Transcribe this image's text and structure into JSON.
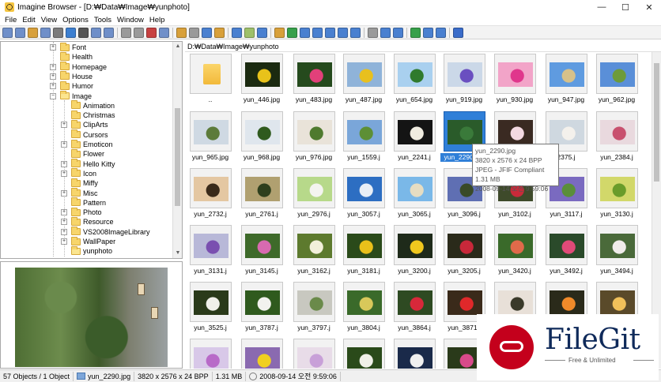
{
  "window": {
    "title": "Imagine Browser - [D:₩Data₩Image₩yunphoto]",
    "minimize": "—",
    "maximize": "☐",
    "close": "✕"
  },
  "menu": [
    "File",
    "Edit",
    "View",
    "Options",
    "Tools",
    "Window",
    "Help"
  ],
  "toolbar": {
    "colors": [
      "#6f8fc9",
      "#6f8fc9",
      "#d8a03a",
      "#6f8fc9",
      "#7b7b7b",
      "#3c7fd0",
      "#555555",
      "#6f8fc9",
      "#6f8fc9",
      "#9a9a9a",
      "#9a9a9a",
      "#c74141",
      "#6f8fc9",
      "#d8a03a",
      "#9a9a9a",
      "#4a80d0",
      "#d8a03a",
      "#4a80d0",
      "#9ec06a",
      "#4a80d0",
      "#d8a03a",
      "#37a04a",
      "#4a80d0",
      "#4a80d0",
      "#4a80d0",
      "#4a80d0",
      "#4a80d0",
      "#9a9a9a",
      "#4a80d0",
      "#4a80d0",
      "#37a04a",
      "#4a80d0",
      "#4a80d0",
      "#3a6cc9"
    ]
  },
  "tree": {
    "items": [
      {
        "label": "Font",
        "depth": 0,
        "expander": "+",
        "open": false
      },
      {
        "label": "Health",
        "depth": 0,
        "expander": "",
        "open": false
      },
      {
        "label": "Homepage",
        "depth": 0,
        "expander": "+",
        "open": false
      },
      {
        "label": "House",
        "depth": 0,
        "expander": "+",
        "open": false
      },
      {
        "label": "Humor",
        "depth": 0,
        "expander": "+",
        "open": false
      },
      {
        "label": "Image",
        "depth": 0,
        "expander": "−",
        "open": true
      },
      {
        "label": "Animation",
        "depth": 1,
        "expander": "",
        "open": false
      },
      {
        "label": "Christmas",
        "depth": 1,
        "expander": "",
        "open": false
      },
      {
        "label": "ClipArts",
        "depth": 1,
        "expander": "+",
        "open": false
      },
      {
        "label": "Cursors",
        "depth": 1,
        "expander": "",
        "open": false
      },
      {
        "label": "Emoticon",
        "depth": 1,
        "expander": "+",
        "open": false
      },
      {
        "label": "Flower",
        "depth": 1,
        "expander": "",
        "open": false
      },
      {
        "label": "Hello Kitty",
        "depth": 1,
        "expander": "+",
        "open": false
      },
      {
        "label": "Icon",
        "depth": 1,
        "expander": "+",
        "open": false
      },
      {
        "label": "Miffy",
        "depth": 1,
        "expander": "",
        "open": false
      },
      {
        "label": "Misc",
        "depth": 1,
        "expander": "+",
        "open": false
      },
      {
        "label": "Pattern",
        "depth": 1,
        "expander": "",
        "open": false
      },
      {
        "label": "Photo",
        "depth": 1,
        "expander": "+",
        "open": false
      },
      {
        "label": "Resource",
        "depth": 1,
        "expander": "+",
        "open": false
      },
      {
        "label": "VS2008ImageLibrary",
        "depth": 1,
        "expander": "+",
        "open": false
      },
      {
        "label": "WallPaper",
        "depth": 1,
        "expander": "+",
        "open": false
      },
      {
        "label": "yunphoto",
        "depth": 1,
        "expander": "",
        "open": true
      }
    ]
  },
  "path": "D:₩Data₩Image₩yunphoto",
  "thumbnails": [
    {
      "label": "..",
      "colors": [
        "#fbd56a",
        "#f2b93a"
      ],
      "folder": true
    },
    {
      "label": "yun_446.jpg",
      "colors": [
        "#1b2a10",
        "#e8c21a"
      ]
    },
    {
      "label": "yun_483.jpg",
      "colors": [
        "#254a1d",
        "#e2407a"
      ]
    },
    {
      "label": "yun_487.jpg",
      "colors": [
        "#8fb3d9",
        "#e8c01e"
      ]
    },
    {
      "label": "yun_654.jpg",
      "colors": [
        "#a9d0ef",
        "#2f7a2d"
      ]
    },
    {
      "label": "yun_919.jpg",
      "colors": [
        "#cbd8e8",
        "#6a4fc0"
      ]
    },
    {
      "label": "yun_930.jpg",
      "colors": [
        "#f2a4c8",
        "#e0368c"
      ]
    },
    {
      "label": "yun_947.jpg",
      "colors": [
        "#5f9be0",
        "#d7c18a"
      ]
    },
    {
      "label": "yun_962.jpg",
      "colors": [
        "#5a8fd8",
        "#6d9b3a"
      ]
    },
    {
      "label": "yun_965.jpg",
      "colors": [
        "#cfd9e3",
        "#5c7b3a"
      ]
    },
    {
      "label": "yun_968.jpg",
      "colors": [
        "#dfe6ed",
        "#2f5a1e"
      ]
    },
    {
      "label": "yun_976.jpg",
      "colors": [
        "#e9e3d9",
        "#4f7a2e"
      ]
    },
    {
      "label": "yun_1559.j",
      "colors": [
        "#7aa6d9",
        "#5d8f36"
      ]
    },
    {
      "label": "yun_2241.j",
      "colors": [
        "#141414",
        "#f0ece0"
      ]
    },
    {
      "label": "yun_2290.jpg",
      "colors": [
        "#2a5b2a",
        "#3a7a3a"
      ],
      "selected": true
    },
    {
      "label": "",
      "colors": [
        "#3a2a22",
        "#f4d9e2"
      ]
    },
    {
      "label": "2375.j",
      "colors": [
        "#cfd8e0",
        "#f4f1ec"
      ]
    },
    {
      "label": "yun_2384.j",
      "colors": [
        "#e9d9de",
        "#c8506e"
      ]
    },
    {
      "label": "yun_2732.j",
      "colors": [
        "#e4c7a2",
        "#3a2a1a"
      ]
    },
    {
      "label": "yun_2761.j",
      "colors": [
        "#b0a070",
        "#2e3f1d"
      ]
    },
    {
      "label": "yun_2976.j",
      "colors": [
        "#b7d98a",
        "#f4f4f0"
      ]
    },
    {
      "label": "yun_3057.j",
      "colors": [
        "#2d6ec2",
        "#e8eef6"
      ]
    },
    {
      "label": "yun_3065.j",
      "colors": [
        "#7ab8e8",
        "#e6ddc2"
      ]
    },
    {
      "label": "yun_3096.j",
      "colors": [
        "#5f6fb3",
        "#394a28"
      ]
    },
    {
      "label": "yun_3102.j",
      "colors": [
        "#3e4a2a",
        "#c82a3a"
      ]
    },
    {
      "label": "yun_3117.j",
      "colors": [
        "#7a6ac0",
        "#5a8e3a"
      ]
    },
    {
      "label": "yun_3130.j",
      "colors": [
        "#d2d86a",
        "#6a9c2a"
      ]
    },
    {
      "label": "yun_3131.j",
      "colors": [
        "#b8b8d8",
        "#7a4fb0"
      ]
    },
    {
      "label": "yun_3145.j",
      "colors": [
        "#3e6a2a",
        "#d86ab0"
      ]
    },
    {
      "label": "yun_3162.j",
      "colors": [
        "#5d7a2e",
        "#f2f0da"
      ]
    },
    {
      "label": "yun_3181.j",
      "colors": [
        "#2a4a1a",
        "#e9c01a"
      ]
    },
    {
      "label": "yun_3200.j",
      "colors": [
        "#1e2a1a",
        "#f0c81e"
      ]
    },
    {
      "label": "yun_3205.j",
      "colors": [
        "#2a2a1a",
        "#c8283a"
      ]
    },
    {
      "label": "yun_3420.j",
      "colors": [
        "#3a6a2a",
        "#e06a4a"
      ]
    },
    {
      "label": "yun_3492.j",
      "colors": [
        "#2a4a2a",
        "#e04a78"
      ]
    },
    {
      "label": "yun_3494.j",
      "colors": [
        "#4a6a3a",
        "#f0ecea"
      ]
    },
    {
      "label": "yun_3525.j",
      "colors": [
        "#2a3a1a",
        "#f0f0ea"
      ]
    },
    {
      "label": "yun_3787.j",
      "colors": [
        "#2f5a1e",
        "#f2f2ee"
      ]
    },
    {
      "label": "yun_3797.j",
      "colors": [
        "#c8c8c0",
        "#6a8a4a"
      ]
    },
    {
      "label": "yun_3804.j",
      "colors": [
        "#3a6a2a",
        "#d8c85a"
      ]
    },
    {
      "label": "yun_3864.j",
      "colors": [
        "#2e4a22",
        "#d8283a"
      ]
    },
    {
      "label": "yun_3871.j",
      "colors": [
        "#3a2a1a",
        "#e0282a"
      ]
    },
    {
      "label": "",
      "colors": [
        "#e8e0d8",
        "#3a3a2a"
      ]
    },
    {
      "label": "",
      "colors": [
        "#2a2a1a",
        "#f08a2a"
      ]
    },
    {
      "label": "",
      "colors": [
        "#5a4a2a",
        "#f0c05a"
      ]
    },
    {
      "label": "",
      "colors": [
        "#d8c8e8",
        "#b86ac8"
      ]
    },
    {
      "label": "",
      "colors": [
        "#8a6ab0",
        "#f0d020"
      ]
    },
    {
      "label": "",
      "colors": [
        "#e8dce8",
        "#c8a0d8"
      ]
    },
    {
      "label": "",
      "colors": [
        "#2a4a1a",
        "#f0f0e8"
      ]
    },
    {
      "label": "",
      "colors": [
        "#1a2a4a",
        "#f0f0f0"
      ]
    },
    {
      "label": "",
      "colors": [
        "#2a3a1a",
        "#d84a8a"
      ]
    }
  ],
  "tooltip": {
    "lines": [
      "yun_2290.jpg",
      "3820 x 2576 x 24 BPP",
      "JPEG - JFIF Compliant",
      "1.31 MB",
      "2008-09-14 오전 9:59:06"
    ]
  },
  "status": {
    "objects": "57 Objects / 1 Object",
    "file": "yun_2290.jpg",
    "dimensions": "3820 x 2576 x 24 BPP",
    "size": "1.31 MB",
    "date": "2008-09-14 오전 9:59:06"
  },
  "watermark": {
    "brand": "FileGit",
    "tagline": "Free & Unlimited"
  }
}
